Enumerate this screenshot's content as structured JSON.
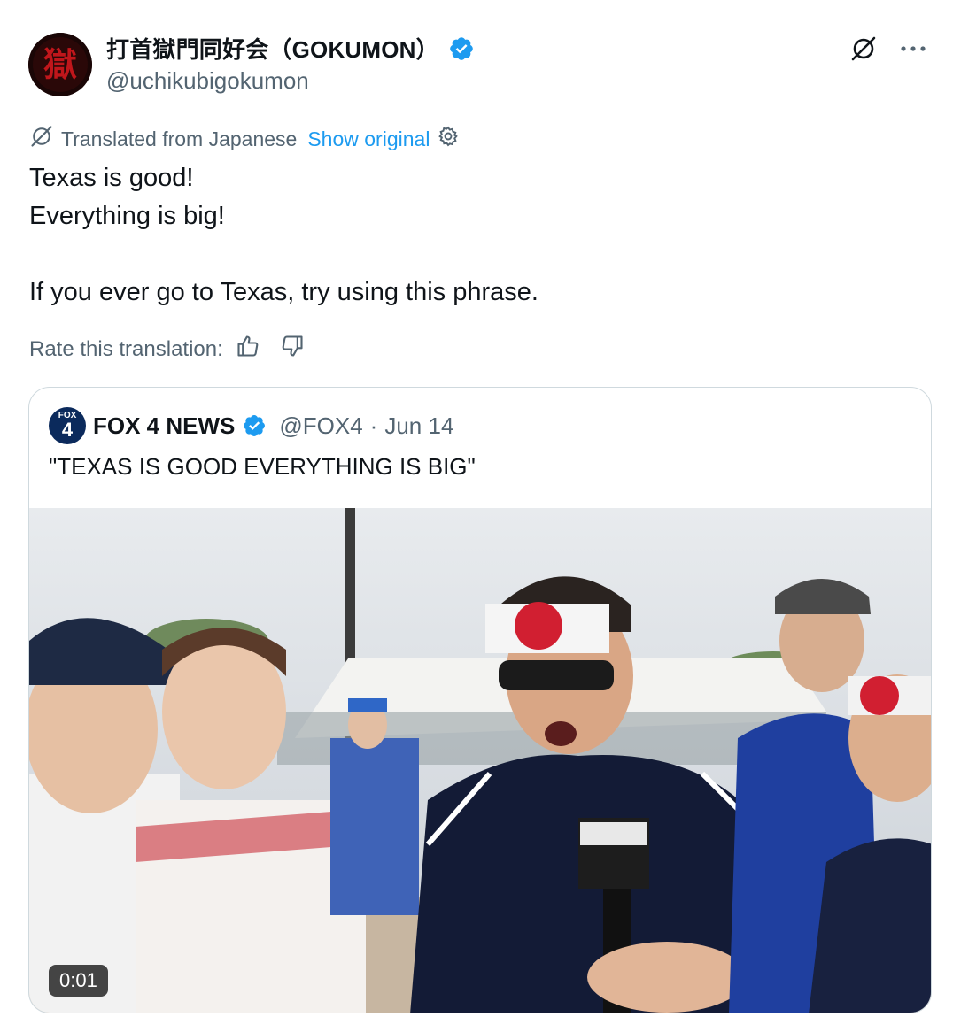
{
  "author": {
    "display_name": "打首獄門同好会（GOKUMON）",
    "handle": "@uchikubigokumon",
    "avatar_glyph": "獄",
    "verified": true
  },
  "translation": {
    "label": "Translated from Japanese",
    "show_original": "Show original"
  },
  "tweet": {
    "lines": [
      "Texas is good!",
      "Everything is big!",
      "If you ever go to Texas, try using this phrase."
    ]
  },
  "rate": {
    "label": "Rate this translation:"
  },
  "quote": {
    "logo_top": "FOX",
    "logo_num": "4",
    "name": "FOX 4 NEWS",
    "handle": "@FOX4",
    "separator": "·",
    "date": "Jun 14",
    "text": "\"TEXAS IS GOOD EVERYTHING IS BIG\"",
    "video_duration": "0:01"
  },
  "colors": {
    "accent": "#1d9bf0",
    "secondary_text": "#536471",
    "border": "#cfd9de"
  },
  "icons": [
    "verified-badge-icon",
    "grok-icon",
    "more-icon",
    "translate-icon",
    "settings-icon",
    "thumbs-up-icon",
    "thumbs-down-icon"
  ]
}
